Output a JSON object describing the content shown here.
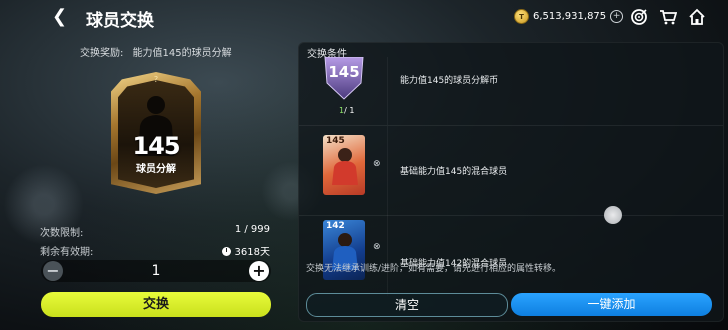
{
  "header": {
    "title": "球员交换",
    "currency_amount": "6,513,931,875"
  },
  "left": {
    "reward_label": "交换奖励:",
    "reward_name": "能力值145的球员分解",
    "pack": {
      "value": "145",
      "name": "球员分解"
    },
    "limit_label": "次数限制:",
    "limit_value": "1 / 999",
    "expiry_label": "剩余有效期:",
    "expiry_value": "3618天",
    "quantity": "1",
    "exchange_label": "交换"
  },
  "conditions": {
    "title": "交换条件",
    "items": [
      {
        "label": "能力值145的球员分解币",
        "count": "1",
        "total": "/ 1",
        "ovr": "145"
      },
      {
        "label": "基础能力值145的混合球员",
        "ovr": "145"
      },
      {
        "label": "基础能力值142的混合球员",
        "ovr": "142"
      }
    ],
    "note": "交换无法继承训练/进阶，如有需要，请先进行相应的属性转移。",
    "clear_label": "清空",
    "add_label": "一键添加"
  },
  "colors": {
    "accent_lime": "#d8ee2a",
    "accent_blue": "#1a8ff0",
    "gold": "#c8961e"
  }
}
